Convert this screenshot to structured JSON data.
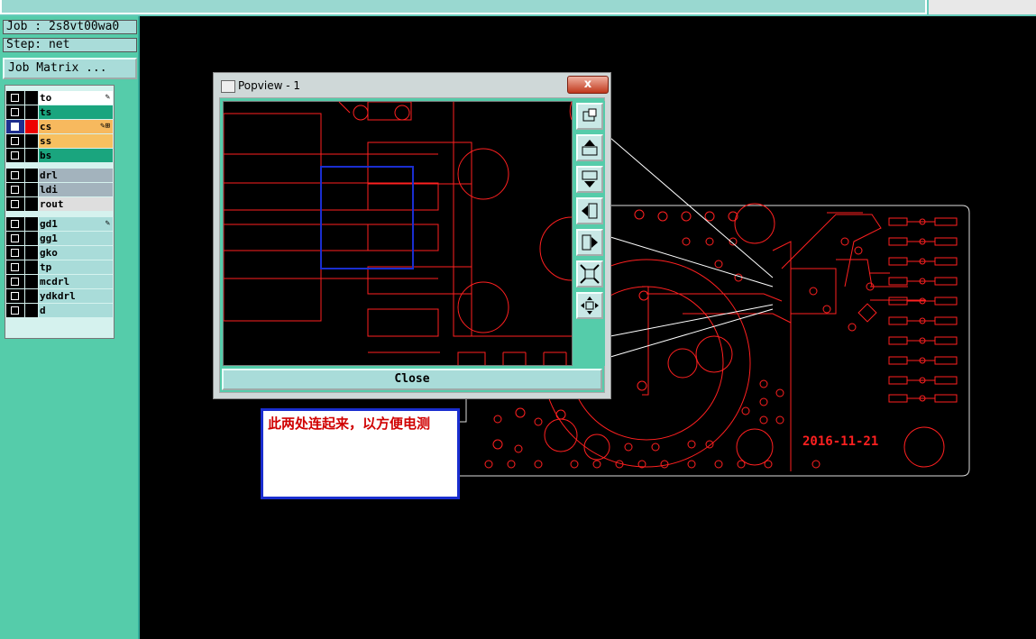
{
  "info": {
    "job": "Job : 2s8vt00wa0",
    "step": "Step: net"
  },
  "job_matrix_button": "Job Matrix ...",
  "layers": [
    {
      "name": "to",
      "color": "#ffffff",
      "checked": false,
      "active": false,
      "marker": "✎"
    },
    {
      "name": "ts",
      "color": "#1aa57e",
      "checked": false,
      "active": false,
      "marker": ""
    },
    {
      "name": "cs",
      "color": "#f7b95e",
      "checked": true,
      "active": true,
      "marker": "✎⊞"
    },
    {
      "name": "ss",
      "color": "#f7c060",
      "checked": false,
      "active": false,
      "marker": ""
    },
    {
      "name": "bs",
      "color": "#1aa57e",
      "checked": false,
      "active": false,
      "marker": ""
    },
    {
      "name": "drl",
      "color": "#a3b3bd",
      "checked": false,
      "active": false,
      "marker": ""
    },
    {
      "name": "ldi",
      "color": "#a3b3bd",
      "checked": false,
      "active": false,
      "marker": ""
    },
    {
      "name": "rout",
      "color": "#dedede",
      "checked": false,
      "active": false,
      "marker": ""
    },
    {
      "name": "gd1",
      "color": "#a9dcd9",
      "checked": false,
      "active": false,
      "marker": "✎"
    },
    {
      "name": "gg1",
      "color": "#a9dcd9",
      "checked": false,
      "active": false,
      "marker": ""
    },
    {
      "name": "gko",
      "color": "#a9dcd9",
      "checked": false,
      "active": false,
      "marker": ""
    },
    {
      "name": "tp",
      "color": "#a9dcd9",
      "checked": false,
      "active": false,
      "marker": ""
    },
    {
      "name": "mcdrl",
      "color": "#a9dcd9",
      "checked": false,
      "active": false,
      "marker": ""
    },
    {
      "name": "ydkdrl",
      "color": "#a9dcd9",
      "checked": false,
      "active": false,
      "marker": ""
    },
    {
      "name": "d",
      "color": "#a9dcd9",
      "checked": false,
      "active": false,
      "marker": ""
    }
  ],
  "popview": {
    "title": "Popview - 1",
    "close_x": "x",
    "close_button": "Close"
  },
  "board": {
    "date_text": "2016-11-21"
  },
  "note": {
    "text": "此两处连起来，以方便电测"
  },
  "colors": {
    "trace": "#ff2020",
    "panel": "#55ccaa",
    "accent": "#1a2ed0"
  }
}
